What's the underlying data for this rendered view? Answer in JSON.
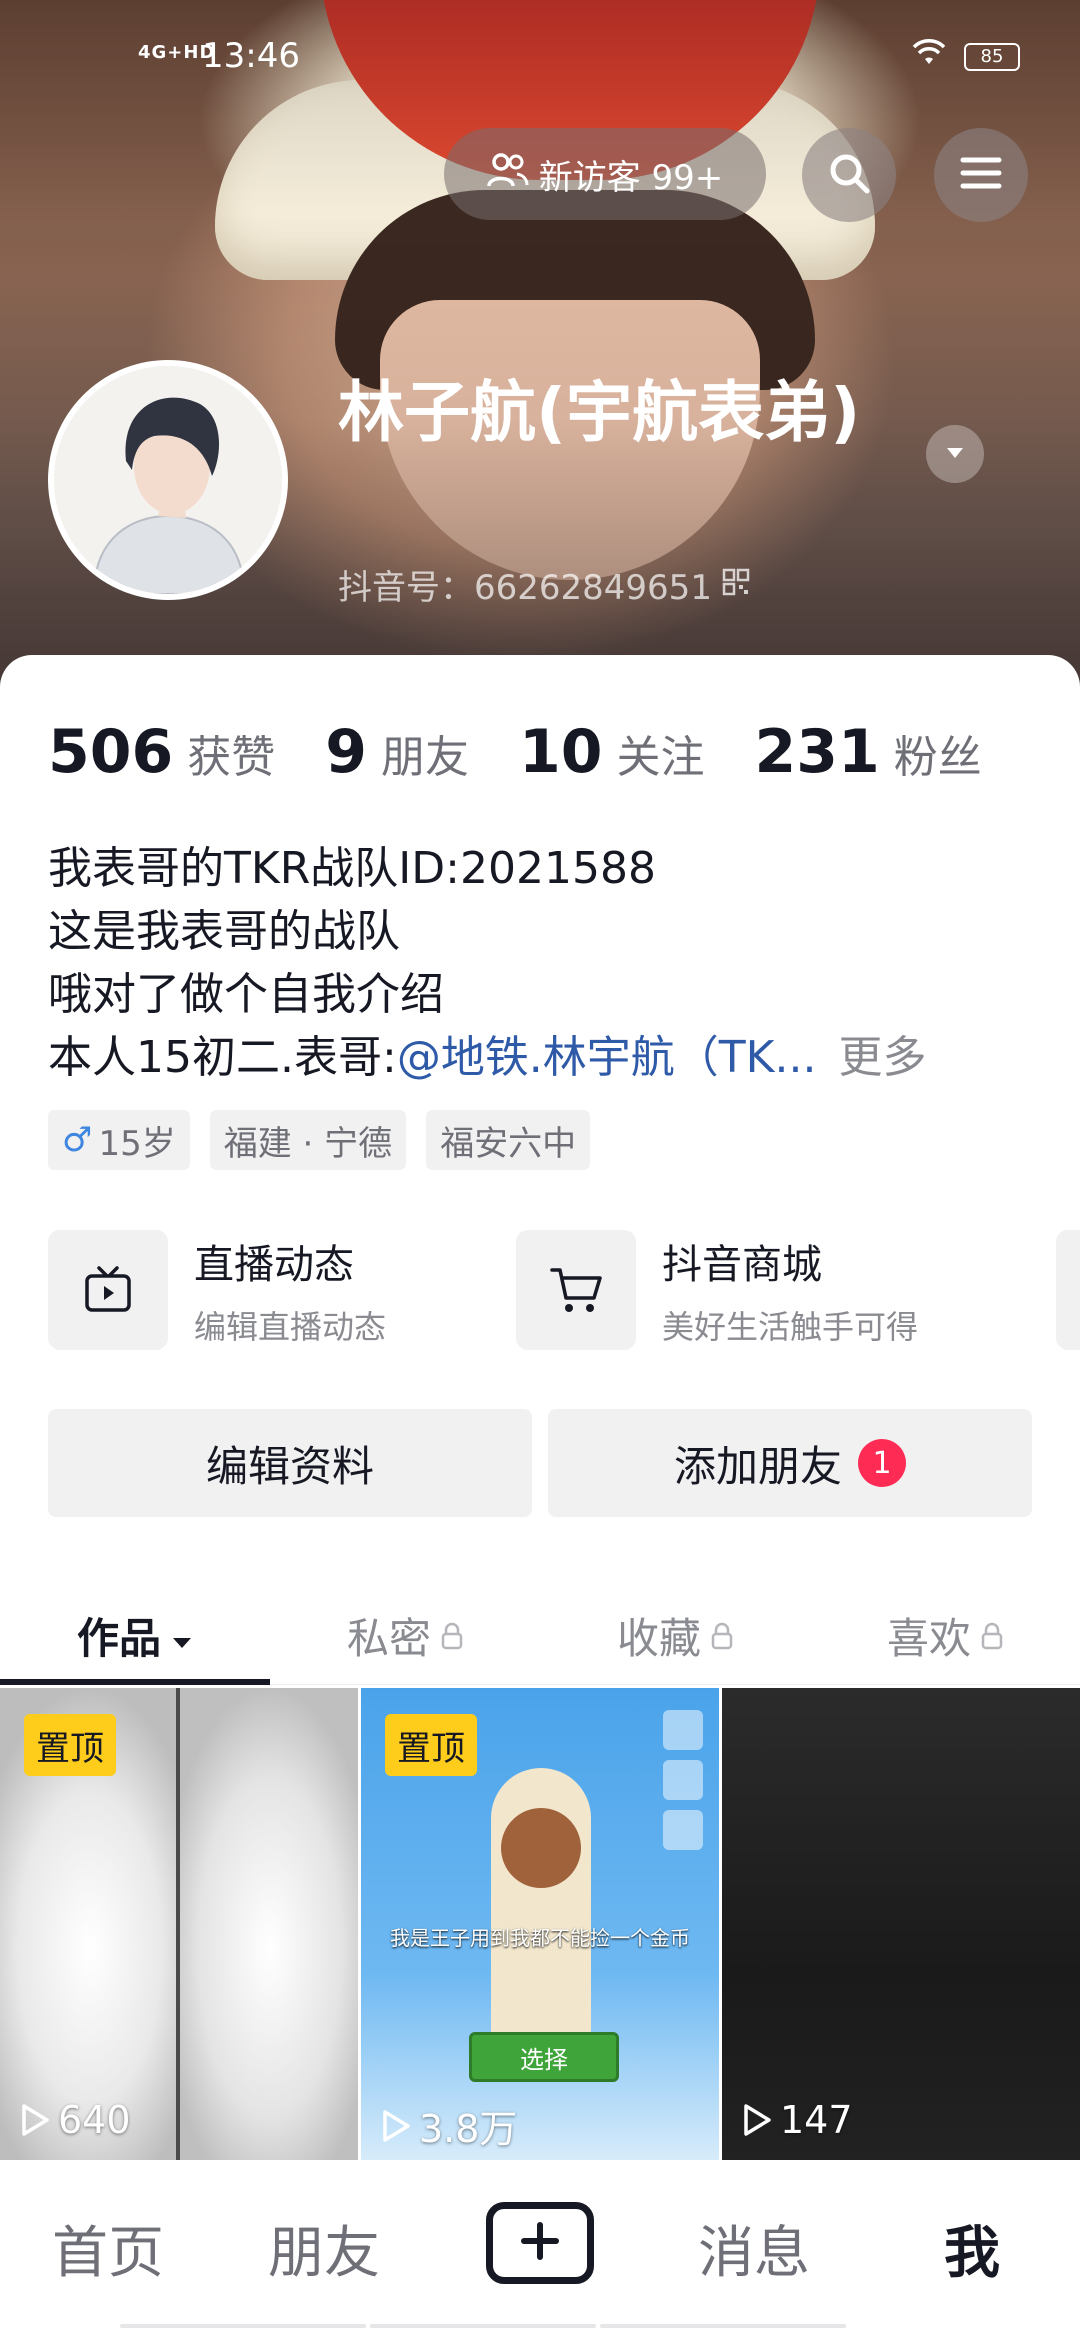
{
  "status_bar": {
    "network": "4G+HD",
    "time": "13:46",
    "battery": "85"
  },
  "header": {
    "visitor_pill_label": "新访客 99+",
    "username": "林子航(宇航表弟)",
    "douyin_id": "抖音号：66262849651"
  },
  "stats": [
    {
      "value": "506",
      "label": "获赞"
    },
    {
      "value": "9",
      "label": "朋友"
    },
    {
      "value": "10",
      "label": "关注"
    },
    {
      "value": "231",
      "label": "粉丝"
    }
  ],
  "bio": {
    "line1": "我表哥的TKR战队ID:2021588",
    "line2": "这是我表哥的战队",
    "line3": "哦对了做个自我介绍",
    "line4_prefix": "本人15初二.表哥:",
    "line4_mention": "@地铁.林宇航（TK...",
    "more": "更多"
  },
  "tags": {
    "gender_symbol": "♂",
    "age": "15岁",
    "location": "福建 · 宁德",
    "school": "福安六中"
  },
  "features": [
    {
      "title": "直播动态",
      "subtitle": "编辑直播动态"
    },
    {
      "title": "抖音商城",
      "subtitle": "美好生活触手可得"
    }
  ],
  "actions": {
    "edit_profile": "编辑资料",
    "add_friend": "添加朋友",
    "add_friend_badge": "1"
  },
  "tabs": [
    {
      "label": "作品",
      "active": true
    },
    {
      "label": "私密",
      "locked": true
    },
    {
      "label": "收藏",
      "locked": true
    },
    {
      "label": "喜欢",
      "locked": true
    }
  ],
  "videos": [
    {
      "pinned_label": "置顶",
      "views": "640"
    },
    {
      "pinned_label": "置顶",
      "views": "3.8万",
      "caption": "我是王子用到我都不能捡一个金币",
      "button": "选择"
    },
    {
      "views": "147"
    }
  ],
  "bottom_nav": [
    {
      "label": "首页"
    },
    {
      "label": "朋友"
    },
    {
      "label": "消息"
    },
    {
      "label": "我",
      "active": true
    }
  ],
  "colors": {
    "accent_red": "#fe2c55",
    "pin_yellow": "#fecd1b",
    "mention_blue": "#2f5aa8",
    "text_primary": "#161823",
    "text_secondary": "#8a8b91"
  }
}
